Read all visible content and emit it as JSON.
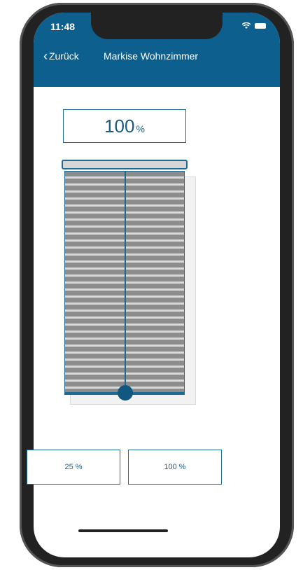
{
  "status_bar": {
    "time": "11:48"
  },
  "nav": {
    "back_label": "Zurück",
    "title": "Markise Wohnzimmer"
  },
  "position": {
    "value": "100",
    "unit": "%",
    "level_fraction": 1.0
  },
  "presets": [
    {
      "label": "25 %"
    },
    {
      "label": "100 %"
    }
  ],
  "colors": {
    "header": "#0d5f8e",
    "accent": "#1d6a96",
    "slats": "#8c8c8c"
  },
  "icons": {
    "back": "chevron-left-icon",
    "wifi": "wifi-icon",
    "battery": "battery-icon"
  }
}
